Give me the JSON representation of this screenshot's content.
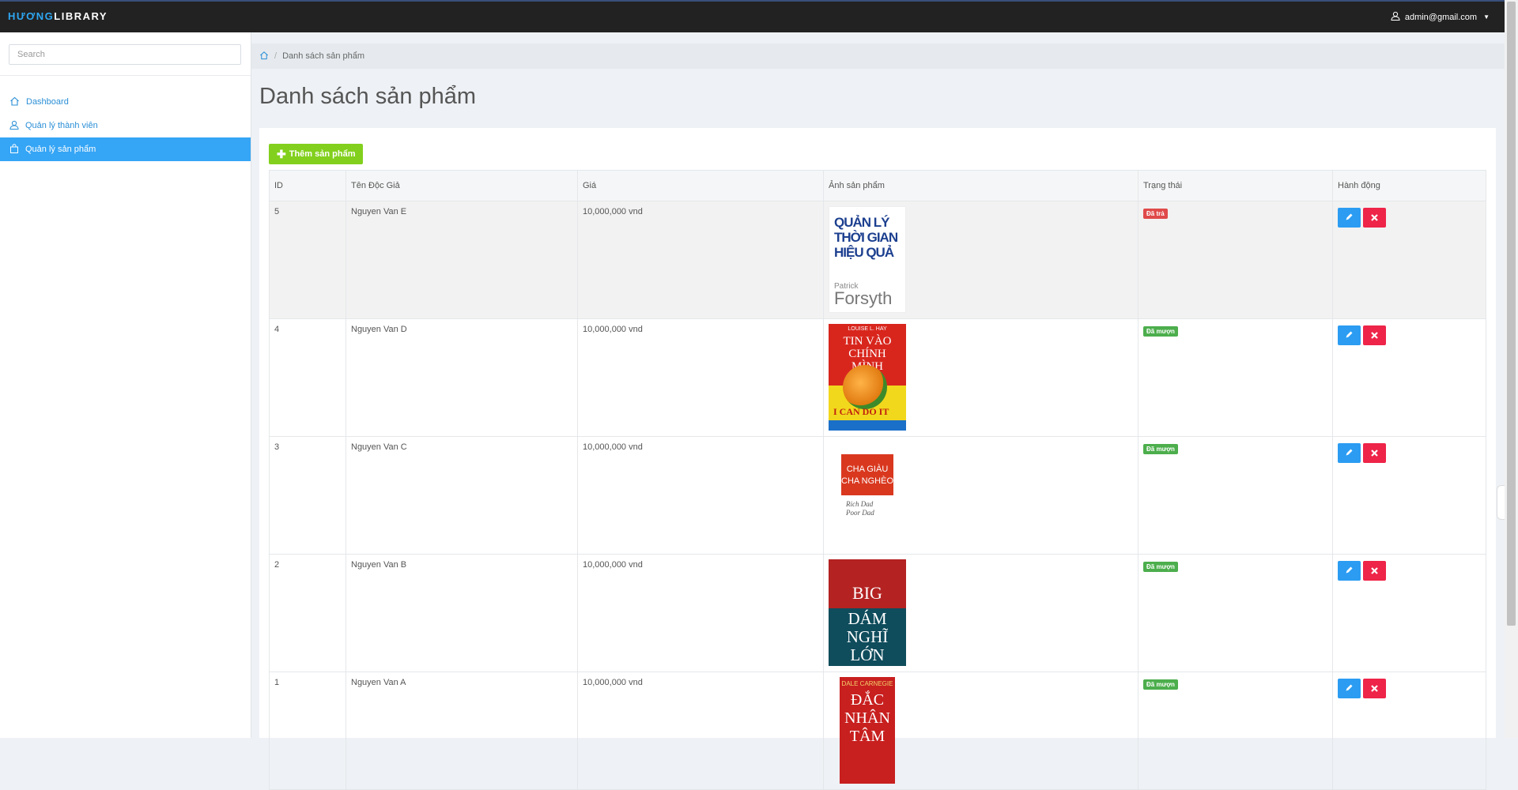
{
  "brand": {
    "part1": "HƯƠNG",
    "part2": "LIBRARY"
  },
  "user": {
    "email": "admin@gmail.com"
  },
  "search": {
    "placeholder": "Search"
  },
  "sidebar": {
    "items": [
      {
        "label": "Dashboard",
        "icon": "home-icon"
      },
      {
        "label": "Quản lý thành viên",
        "icon": "user-icon"
      },
      {
        "label": "Quản lý sản phẩm",
        "icon": "bag-icon",
        "active": true
      }
    ]
  },
  "breadcrumb": {
    "current": "Danh sách sản phẩm"
  },
  "page": {
    "title": "Danh sách sản phẩm",
    "add_label": "Thêm sản phẩm"
  },
  "table": {
    "headers": [
      "ID",
      "Tên Độc Giả",
      "Giá",
      "Ảnh sản phẩm",
      "Trạng thái",
      "Hành động"
    ],
    "rows": [
      {
        "id": "5",
        "name": "Nguyen Van E",
        "price": "10,000,000 vnd",
        "status": "Đã trả",
        "status_color": "#e04a4a",
        "cover": {
          "title_lines": [
            "QUẢN LÝ",
            "THỜI GIAN",
            "HIỆU QUẢ"
          ],
          "author_small": "Patrick",
          "author": "Forsyth"
        }
      },
      {
        "id": "4",
        "name": "Nguyen Van D",
        "price": "10,000,000 vnd",
        "status": "Đã mượn",
        "status_color": "#4cae4c",
        "cover": {
          "author": "LOUISE L. HAY",
          "title_lines": [
            "TIN VÀO",
            "CHÍNH MÌNH"
          ],
          "subtitle": "I CAN DO IT"
        }
      },
      {
        "id": "3",
        "name": "Nguyen Van C",
        "price": "10,000,000 vnd",
        "status": "Đã mượn",
        "status_color": "#4cae4c",
        "cover": {
          "title_lines": [
            "CHA GIÀU",
            "CHA NGHÈO"
          ],
          "subtitle_lines": [
            "Rich Dad",
            "Poor Dad"
          ]
        }
      },
      {
        "id": "2",
        "name": "Nguyen Van B",
        "price": "10,000,000 vnd",
        "status": "Đã mượn",
        "status_color": "#4cae4c",
        "cover": {
          "title_top": "BIG",
          "title_lines": [
            "DÁM",
            "NGHĨ",
            "LỚN"
          ]
        }
      },
      {
        "id": "1",
        "name": "Nguyen Van A",
        "price": "10,000,000 vnd",
        "status": "Đã mượn",
        "status_color": "#4cae4c",
        "cover": {
          "author": "DALE CARNEGIE",
          "title_lines": [
            "ĐẮC",
            "NHÂN",
            "TÂM"
          ]
        }
      }
    ]
  },
  "colors": {
    "accent": "#35a5f5",
    "add_button": "#82d01d",
    "edit": "#2b9cf2",
    "delete": "#ee2448"
  }
}
